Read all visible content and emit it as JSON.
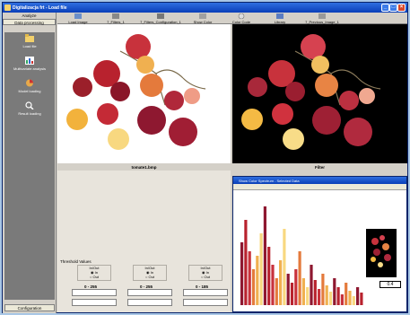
{
  "window": {
    "title": "Digitalizacja frt - Load file"
  },
  "sidebar": {
    "header": "Analyze",
    "section": "Data processing",
    "items": [
      {
        "label": "Load file",
        "icon": "open-file-icon"
      },
      {
        "label": "Multivariate analysis",
        "icon": "chart-icon"
      },
      {
        "label": "Model loading",
        "icon": "pie-chart-icon"
      },
      {
        "label": "Result loading",
        "icon": "magnifier-icon"
      }
    ],
    "footer": "Configuration"
  },
  "toolbar": [
    {
      "label": "Load Image",
      "icon": "image-icon"
    },
    {
      "label": "7_Filters_1",
      "icon": "filter-icon"
    },
    {
      "label": "7_Filters_Configuration_1",
      "icon": "filter-config-icon"
    },
    {
      "label": "Show Color Spectrum",
      "icon": "spectrum-icon"
    },
    {
      "label": "Color Code",
      "icon": "color-code-icon"
    },
    {
      "label": "Library",
      "icon": "library-icon"
    },
    {
      "label": "7_Previous_Image_1",
      "icon": "previous-image-icon"
    }
  ],
  "images": {
    "left_caption": "tomate1.bmp",
    "right_caption": "Filter"
  },
  "threshold": {
    "label": "Threshold Values",
    "groups": [
      {
        "title": "In/Out",
        "opt_in": "In",
        "opt_out": "Out",
        "range": "0 - 255"
      },
      {
        "title": "In/Out",
        "opt_in": "In",
        "opt_out": "Out",
        "range": "0 - 255"
      },
      {
        "title": "In/Out",
        "opt_in": "In",
        "opt_out": "Out",
        "range": "0 - 185"
      }
    ]
  },
  "spectrum": {
    "title": "Show Color Spectrum - Selected Data",
    "value": "0.4"
  },
  "colors": {
    "title_bar": "#0a3fb8",
    "sidebar_panel": "#7a7a7a",
    "desktop": "#a9c7e6"
  }
}
